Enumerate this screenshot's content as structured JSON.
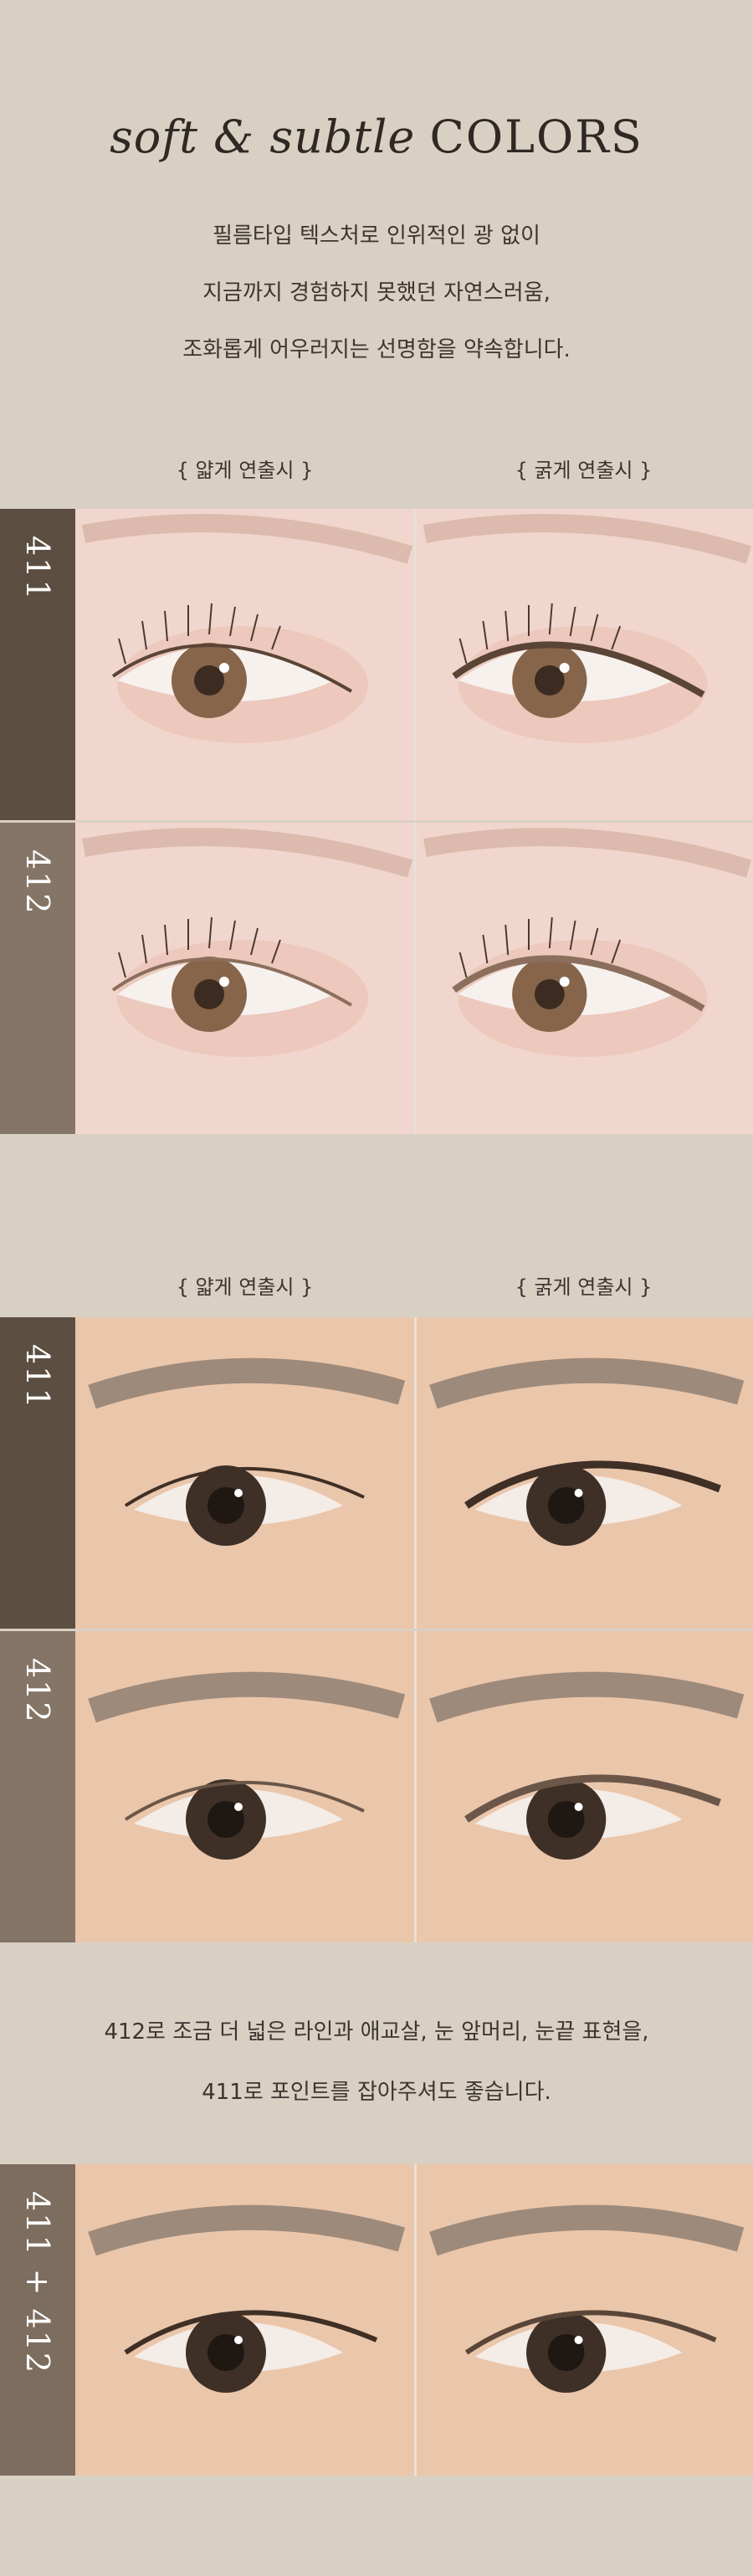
{
  "header": {
    "title_italic": "soft & subtle",
    "title_caps": "COLORS",
    "intro_lines": [
      "필름타입 텍스처로 인위적인 광 없이",
      "지금까지 경험하지 못했던 자연스러움,",
      "조화롭게 어우러지는 선명함을 약속합니다."
    ]
  },
  "section1": {
    "col_thin": "{ 얇게 연출시 }",
    "col_thick": "{ 굵게 연출시 }",
    "rows": [
      {
        "shade": "411",
        "color": "#5c4e41"
      },
      {
        "shade": "412",
        "color": "#857566"
      }
    ]
  },
  "section2": {
    "col_thin": "{ 얇게 연출시 }",
    "col_thick": "{ 굵게 연출시 }",
    "rows": [
      {
        "shade": "411",
        "color": "#5c4e41"
      },
      {
        "shade": "412",
        "color": "#857566"
      }
    ]
  },
  "tip_lines": [
    "412로 조금 더 넓은 라인과 애교살, 눈 앞머리, 눈끝 표현을,",
    "411로 포인트를 잡아주셔도 좋습니다."
  ],
  "combo": {
    "shade": "411 + 412",
    "color": "#7d6d5f"
  },
  "colors": {
    "background": "#d9d0c4",
    "skin_light": "#f1d4cb",
    "skin_warm": "#e8c4a8",
    "iris_light": "#7a5c42",
    "iris_dark": "#3a2c22"
  }
}
